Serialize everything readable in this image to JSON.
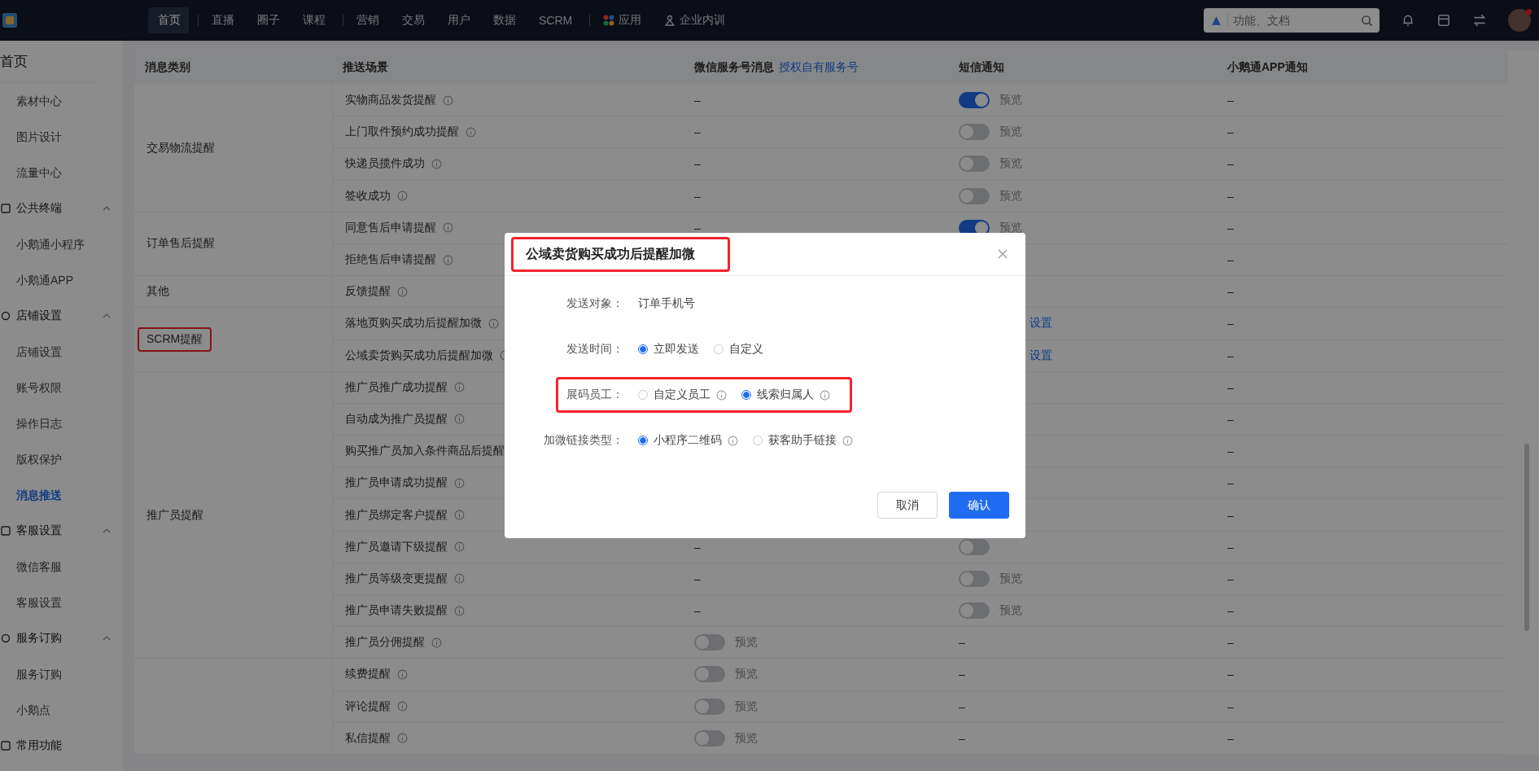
{
  "top_nav": {
    "tabs": [
      {
        "label": "首页",
        "selected": true,
        "kind": "plain",
        "separator_after": true
      },
      {
        "label": "直播",
        "selected": false,
        "kind": "plain",
        "separator_after": false
      },
      {
        "label": "圈子",
        "selected": false,
        "kind": "plain",
        "separator_after": false
      },
      {
        "label": "课程",
        "selected": false,
        "kind": "plain",
        "separator_after": true
      },
      {
        "label": "营销",
        "selected": false,
        "kind": "plain",
        "separator_after": false
      },
      {
        "label": "交易",
        "selected": false,
        "kind": "plain",
        "separator_after": false
      },
      {
        "label": "用户",
        "selected": false,
        "kind": "plain",
        "separator_after": false
      },
      {
        "label": "数据",
        "selected": false,
        "kind": "plain",
        "separator_after": false
      },
      {
        "label": "SCRM",
        "selected": false,
        "kind": "plain",
        "separator_after": true
      },
      {
        "label": "应用",
        "selected": false,
        "kind": "apps",
        "separator_after": false
      },
      {
        "label": "企业内训",
        "selected": false,
        "kind": "training",
        "separator_after": false
      }
    ],
    "search": {
      "placeholder": "功能、文档"
    }
  },
  "sidebar": {
    "title": "首页",
    "items": [
      {
        "kind": "link",
        "label": "素材中心",
        "selected": false
      },
      {
        "kind": "link",
        "label": "图片设计",
        "selected": false
      },
      {
        "kind": "link",
        "label": "流量中心",
        "selected": false
      },
      {
        "kind": "group",
        "label": "公共终端",
        "expanded": true,
        "children": [
          {
            "label": "小鹅通小程序",
            "selected": false
          },
          {
            "label": "小鹅通APP",
            "selected": false
          }
        ]
      },
      {
        "kind": "group",
        "label": "店铺设置",
        "expanded": true,
        "children": [
          {
            "label": "店铺设置",
            "selected": false
          },
          {
            "label": "账号权限",
            "selected": false
          },
          {
            "label": "操作日志",
            "selected": false
          },
          {
            "label": "版权保护",
            "selected": false
          },
          {
            "label": "消息推送",
            "selected": true
          }
        ]
      },
      {
        "kind": "group",
        "label": "客服设置",
        "expanded": true,
        "children": [
          {
            "label": "微信客服",
            "selected": false
          },
          {
            "label": "客服设置",
            "selected": false
          }
        ]
      },
      {
        "kind": "group",
        "label": "服务订购",
        "expanded": true,
        "children": [
          {
            "label": "服务订购",
            "selected": false
          },
          {
            "label": "小鹅点",
            "selected": false
          }
        ]
      },
      {
        "kind": "group",
        "label": "常用功能"
      }
    ]
  },
  "table": {
    "columns": [
      {
        "label": "消息类别"
      },
      {
        "label": "推送场景"
      },
      {
        "label": "微信服务号消息",
        "link": "授权自有服务号"
      },
      {
        "label": "短信通知"
      },
      {
        "label": "小鹅通APP通知"
      }
    ],
    "groups": [
      {
        "label": "交易物流提醒",
        "highlighted": false,
        "rows": [
          {
            "scene": "实物商品发货提醒",
            "info": true,
            "cells": [
              {
                "kind": "dash",
                "text": "–"
              },
              {
                "kind": "toggle",
                "on": true,
                "text": "预览"
              },
              {
                "kind": "dash",
                "text": "–"
              }
            ]
          },
          {
            "scene": "上门取件预约成功提醒",
            "info": true,
            "cells": [
              {
                "kind": "dash",
                "text": "–"
              },
              {
                "kind": "toggle",
                "on": false,
                "text": "预览"
              },
              {
                "kind": "dash",
                "text": "–"
              }
            ]
          },
          {
            "scene": "快递员揽件成功",
            "info": true,
            "cells": [
              {
                "kind": "dash",
                "text": "–"
              },
              {
                "kind": "toggle",
                "on": false,
                "text": "预览"
              },
              {
                "kind": "dash",
                "text": "–"
              }
            ]
          },
          {
            "scene": "签收成功",
            "info": true,
            "cells": [
              {
                "kind": "dash",
                "text": "–"
              },
              {
                "kind": "toggle",
                "on": false,
                "text": "预览"
              },
              {
                "kind": "dash",
                "text": "–"
              }
            ]
          }
        ]
      },
      {
        "label": "订单售后提醒",
        "highlighted": false,
        "rows": [
          {
            "scene": "同意售后申请提醒",
            "info": true,
            "cells": [
              {
                "kind": "dash",
                "text": "–"
              },
              {
                "kind": "toggle",
                "on": true,
                "text": "预览"
              },
              {
                "kind": "dash",
                "text": "–"
              }
            ]
          },
          {
            "scene": "拒绝售后申请提醒",
            "info": true,
            "cells": [
              {
                "kind": "blank"
              },
              {
                "kind": "blank"
              },
              {
                "kind": "dash",
                "text": "–"
              }
            ]
          }
        ]
      },
      {
        "label": "其他",
        "highlighted": false,
        "rows": [
          {
            "scene": "反馈提醒",
            "info": true,
            "cells": [
              {
                "kind": "blank"
              },
              {
                "kind": "blank"
              },
              {
                "kind": "dash",
                "text": "–"
              }
            ]
          }
        ]
      },
      {
        "label": "SCRM提醒",
        "highlighted": true,
        "rows": [
          {
            "scene": "落地页购买成功后提醒加微",
            "info": true,
            "cells": [
              {
                "kind": "blank"
              },
              {
                "kind": "link",
                "text": "设置"
              },
              {
                "kind": "dash",
                "text": "–"
              }
            ]
          },
          {
            "scene": "公域卖货购买成功后提醒加微",
            "info": true,
            "cells": [
              {
                "kind": "blank"
              },
              {
                "kind": "link",
                "text": "设置"
              },
              {
                "kind": "dash",
                "text": "–"
              }
            ]
          }
        ]
      },
      {
        "label": "推广员提醒",
        "highlighted": false,
        "rows": [
          {
            "scene": "推广员推广成功提醒",
            "info": true,
            "cells": [
              {
                "kind": "blank"
              },
              {
                "kind": "blank"
              },
              {
                "kind": "dash",
                "text": "–"
              }
            ]
          },
          {
            "scene": "自动成为推广员提醒",
            "info": true,
            "cells": [
              {
                "kind": "blank"
              },
              {
                "kind": "blank"
              },
              {
                "kind": "dash",
                "text": "–"
              }
            ]
          },
          {
            "scene": "购买推广员加入条件商品后提醒",
            "cells": [
              {
                "kind": "blank"
              },
              {
                "kind": "blank"
              },
              {
                "kind": "dash",
                "text": "–"
              }
            ]
          },
          {
            "scene": "推广员申请成功提醒",
            "info": true,
            "cells": [
              {
                "kind": "blank"
              },
              {
                "kind": "blank"
              },
              {
                "kind": "dash",
                "text": "–"
              }
            ]
          },
          {
            "scene": "推广员绑定客户提醒",
            "info": true,
            "cells": [
              {
                "kind": "blank"
              },
              {
                "kind": "blank"
              },
              {
                "kind": "dash",
                "text": "–"
              }
            ]
          },
          {
            "scene": "推广员邀请下级提醒",
            "info": true,
            "cells": [
              {
                "kind": "dash",
                "text": "–"
              },
              {
                "kind": "toggle",
                "on": false
              },
              {
                "kind": "dash",
                "text": "–"
              }
            ]
          },
          {
            "scene": "推广员等级变更提醒",
            "info": true,
            "cells": [
              {
                "kind": "dash",
                "text": "–"
              },
              {
                "kind": "toggle",
                "on": false,
                "text": "预览"
              },
              {
                "kind": "dash",
                "text": "–"
              }
            ]
          },
          {
            "scene": "推广员申请失败提醒",
            "info": true,
            "cells": [
              {
                "kind": "dash",
                "text": "–"
              },
              {
                "kind": "toggle",
                "on": false,
                "text": "预览"
              },
              {
                "kind": "dash",
                "text": "–"
              }
            ]
          },
          {
            "scene": "推广员分佣提醒",
            "info": true,
            "cells": [
              {
                "kind": "toggle",
                "on": false,
                "text": "预览"
              },
              {
                "kind": "dash",
                "text": "–"
              },
              {
                "kind": "dash",
                "text": "–"
              }
            ]
          }
        ]
      },
      {
        "rows": [
          {
            "scene": "续费提醒",
            "info": true,
            "cells": [
              {
                "kind": "toggle",
                "on": false,
                "text": "预览"
              },
              {
                "kind": "dash",
                "text": "–"
              },
              {
                "kind": "dash",
                "text": "–"
              }
            ]
          },
          {
            "scene": "评论提醒",
            "info": true,
            "cells": [
              {
                "kind": "toggle",
                "on": false,
                "text": "预览"
              },
              {
                "kind": "dash",
                "text": "–"
              },
              {
                "kind": "dash",
                "text": "–"
              }
            ]
          },
          {
            "scene": "私信提醒",
            "info": true,
            "cells": [
              {
                "kind": "toggle",
                "on": false,
                "text": "预览"
              },
              {
                "kind": "dash",
                "text": "–"
              },
              {
                "kind": "dash",
                "text": "–"
              }
            ]
          }
        ]
      }
    ]
  },
  "dialog": {
    "title": "公域卖货购买成功后提醒加微",
    "title_highlighted": true,
    "fields": [
      {
        "kind": "text",
        "label": "发送对象：",
        "value": "订单手机号"
      },
      {
        "kind": "radio",
        "label": "发送时间：",
        "options": [
          {
            "label": "立即发送",
            "selected": true
          },
          {
            "label": "自定义",
            "selected": false
          }
        ]
      },
      {
        "kind": "radio",
        "label": "展码员工：",
        "highlighted": true,
        "options": [
          {
            "label": "自定义员工",
            "selected": false,
            "info": true
          },
          {
            "label": "线索归属人",
            "selected": true,
            "info": true
          }
        ]
      },
      {
        "kind": "radio",
        "label": "加微链接类型：",
        "options": [
          {
            "label": "小程序二维码",
            "selected": true,
            "info": true
          },
          {
            "label": "获客助手链接",
            "selected": false,
            "info": true
          }
        ]
      }
    ],
    "buttons": [
      {
        "label": "取消",
        "kind": "secondary"
      },
      {
        "label": "确认",
        "kind": "primary"
      }
    ]
  }
}
